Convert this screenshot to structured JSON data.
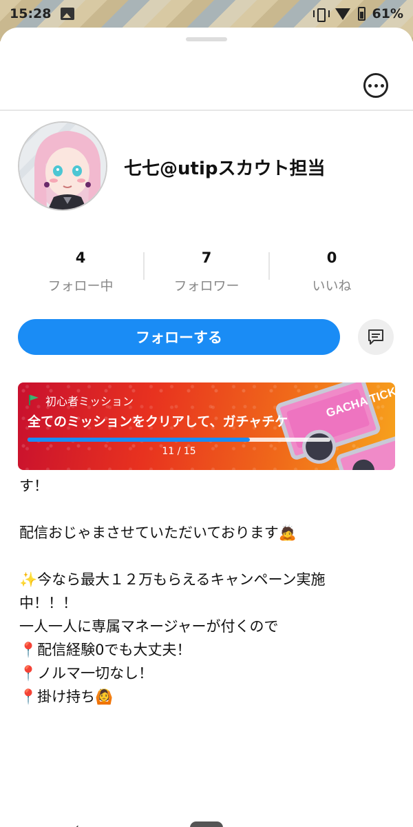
{
  "status_bar": {
    "time": "15:28",
    "battery": "61%",
    "icons": [
      "image-icon",
      "vibrate-icon",
      "wifi-icon",
      "battery-icon"
    ]
  },
  "profile": {
    "name": "七七@utipスカウト担当"
  },
  "stats": [
    {
      "value": "4",
      "label": "フォロー中"
    },
    {
      "value": "7",
      "label": "フォロワー"
    },
    {
      "value": "0",
      "label": "いいね"
    }
  ],
  "actions": {
    "follow": "フォローする"
  },
  "mission": {
    "tag": "初心者ミッション",
    "text": "全てのミッションをクリアして、ガチャチケ",
    "progress_text": "11 / 15",
    "progress_fraction": 0.733,
    "ticket_text": "GACHA TICKET"
  },
  "bio": [
    "す！",
    "",
    "配信おじゃまさせていただいております🙇",
    "",
    "✨今なら最大１２万もらえるキャンペーン実施",
    "中！！！",
    "一人一人に専属マネージャーが付くので",
    "📍配信経験0でも大丈夫！",
    "📍ノルマ一切なし！",
    "📍掛け持ち🙆"
  ],
  "colors": {
    "accent": "#1a8cf5",
    "banner_start": "#c8102e",
    "banner_end": "#f7a31c"
  }
}
